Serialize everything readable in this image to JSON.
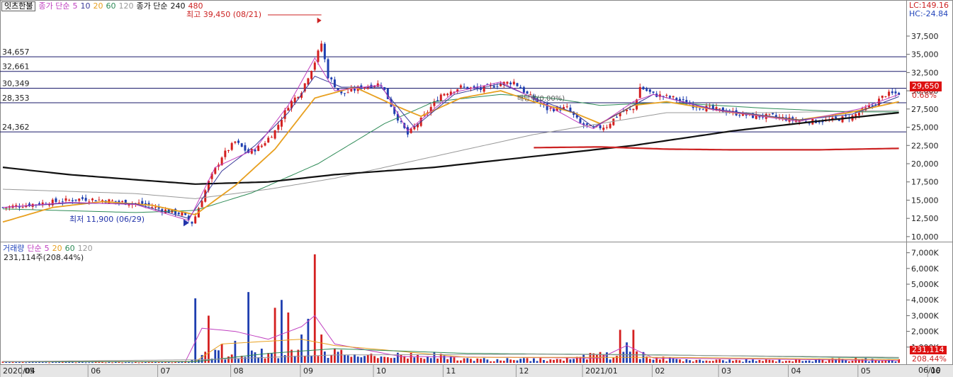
{
  "legend_top": {
    "stock_button": "잇츠한불",
    "ma_prefix": "종가 단순",
    "ma_items": [
      {
        "label": "5",
        "color": "#c040c0"
      },
      {
        "label": "10",
        "color": "#3a3a9a"
      },
      {
        "label": "20",
        "color": "#e8a020"
      },
      {
        "label": "60",
        "color": "#2e8b57"
      },
      {
        "label": "120",
        "color": "#999999"
      }
    ],
    "ma_prefix2": "종가 단순",
    "ma_items2": [
      {
        "label": "240",
        "color": "#111111"
      },
      {
        "label": "480",
        "color": "#cc2222"
      }
    ]
  },
  "top_right": {
    "lc": "LC:149.16",
    "hc": "HC:-24.84"
  },
  "price_axis": {
    "ticks": [
      "37,500",
      "35,000",
      "32,500",
      "30,000",
      "27,500",
      "25,000",
      "22,500",
      "20,000",
      "17,500",
      "15,000",
      "12,500",
      "10,000"
    ],
    "current_price": "29,650",
    "change_pct": "0.68%"
  },
  "h_lines": [
    {
      "label": "34,657",
      "value": 34657
    },
    {
      "label": "32,661",
      "value": 32661
    },
    {
      "label": "30,349",
      "value": 30349
    },
    {
      "label": "28,353",
      "value": 28353
    },
    {
      "label": "24,362",
      "value": 24362
    }
  ],
  "annotations": {
    "high": "최고 39,450 (08/21)",
    "low": "최저 11,900 (06/29)",
    "dividend": "배당락(0.00%)"
  },
  "volume_panel": {
    "legend_prefix": "거래량",
    "legend_ma": "단순",
    "ma_items": [
      {
        "label": "5",
        "color": "#c040c0"
      },
      {
        "label": "20",
        "color": "#e8a020"
      },
      {
        "label": "60",
        "color": "#2e8b57"
      },
      {
        "label": "120",
        "color": "#999999"
      }
    ],
    "current_volume_text": "231,114주(208.44%)",
    "axis_ticks": [
      "7,000K",
      "6,000K",
      "5,000K",
      "4,000K",
      "3,000K",
      "2,000K",
      "1,000K"
    ],
    "current_volume_box": "231,114",
    "current_pct": "208.44%"
  },
  "x_axis": {
    "labels": [
      "2020/04",
      "05",
      "06",
      "07",
      "08",
      "09",
      "10",
      "11",
      "12",
      "2021/01",
      "02",
      "03",
      "04",
      "05",
      "06"
    ],
    "corner_date": "06/10"
  },
  "chart_data": {
    "type": "candlestick",
    "price_range": [
      9600,
      40700
    ],
    "volume_range_k": [
      0,
      7300
    ],
    "months": [
      "2020/04",
      "05",
      "06",
      "07",
      "08",
      "09",
      "10",
      "11",
      "12",
      "2021/01",
      "02",
      "03",
      "04",
      "05",
      "06"
    ],
    "high": {
      "value": 39450,
      "date": "08/21"
    },
    "low": {
      "value": 11900,
      "date": "06/29"
    },
    "last_close": 29650,
    "last_volume": 231114,
    "horizontal_levels": [
      34657,
      32661,
      30349,
      28353,
      24362
    ],
    "close_path": [
      [
        0,
        14000
      ],
      [
        6,
        14300
      ],
      [
        12,
        14600
      ],
      [
        18,
        14900
      ],
      [
        24,
        15200
      ],
      [
        30,
        15000
      ],
      [
        36,
        14700
      ],
      [
        42,
        14500
      ],
      [
        48,
        13700
      ],
      [
        54,
        13100
      ],
      [
        57,
        11900
      ],
      [
        58,
        12800
      ],
      [
        62,
        17500
      ],
      [
        66,
        21000
      ],
      [
        70,
        23000
      ],
      [
        74,
        21500
      ],
      [
        78,
        22500
      ],
      [
        82,
        24500
      ],
      [
        86,
        28000
      ],
      [
        90,
        30000
      ],
      [
        94,
        34000
      ],
      [
        96,
        36500
      ],
      [
        98,
        32000
      ],
      [
        102,
        29500
      ],
      [
        108,
        30500
      ],
      [
        114,
        31000
      ],
      [
        118,
        27000
      ],
      [
        122,
        24000
      ],
      [
        126,
        26000
      ],
      [
        132,
        29500
      ],
      [
        138,
        30500
      ],
      [
        144,
        30200
      ],
      [
        150,
        31000
      ],
      [
        154,
        31200
      ],
      [
        158,
        29500
      ],
      [
        164,
        27500
      ],
      [
        170,
        27600
      ],
      [
        174,
        25500
      ],
      [
        178,
        24800
      ],
      [
        182,
        25200
      ],
      [
        186,
        27000
      ],
      [
        190,
        27500
      ],
      [
        192,
        30500
      ],
      [
        196,
        29500
      ],
      [
        202,
        29000
      ],
      [
        208,
        28000
      ],
      [
        214,
        27500
      ],
      [
        220,
        27000
      ],
      [
        226,
        26500
      ],
      [
        232,
        26500
      ],
      [
        238,
        26000
      ],
      [
        244,
        25800
      ],
      [
        250,
        26000
      ],
      [
        256,
        26500
      ],
      [
        262,
        28000
      ],
      [
        266,
        29500
      ],
      [
        270,
        29650
      ]
    ],
    "ma_series": [
      {
        "name": "120",
        "color": "#999999",
        "points": [
          [
            0,
            16500
          ],
          [
            40,
            15900
          ],
          [
            58,
            15200
          ],
          [
            80,
            16500
          ],
          [
            100,
            18000
          ],
          [
            130,
            21000
          ],
          [
            160,
            24000
          ],
          [
            180,
            25500
          ],
          [
            200,
            27000
          ],
          [
            230,
            27000
          ],
          [
            270,
            27300
          ]
        ]
      },
      {
        "name": "60",
        "color": "#2e8b57",
        "points": [
          [
            0,
            13800
          ],
          [
            40,
            13300
          ],
          [
            58,
            13600
          ],
          [
            75,
            16000
          ],
          [
            95,
            20000
          ],
          [
            115,
            25500
          ],
          [
            130,
            28500
          ],
          [
            150,
            29500
          ],
          [
            165,
            29000
          ],
          [
            180,
            28000
          ],
          [
            200,
            28400
          ],
          [
            230,
            27600
          ],
          [
            255,
            27100
          ],
          [
            270,
            27100
          ]
        ]
      },
      {
        "name": "240",
        "color": "#111111",
        "points": [
          [
            0,
            19500
          ],
          [
            20,
            18500
          ],
          [
            40,
            17800
          ],
          [
            58,
            17200
          ],
          [
            80,
            17500
          ],
          [
            100,
            18500
          ],
          [
            130,
            19500
          ],
          [
            160,
            21000
          ],
          [
            190,
            22500
          ],
          [
            220,
            24500
          ],
          [
            245,
            25800
          ],
          [
            270,
            27000
          ]
        ]
      },
      {
        "name": "480",
        "color": "#cc2222",
        "points": [
          [
            160,
            22200
          ],
          [
            180,
            22300
          ],
          [
            200,
            22000
          ],
          [
            220,
            21900
          ],
          [
            245,
            21900
          ],
          [
            270,
            22100
          ]
        ]
      },
      {
        "name": "20",
        "color": "#e8a020",
        "points": [
          [
            0,
            12000
          ],
          [
            15,
            14000
          ],
          [
            30,
            14800
          ],
          [
            45,
            14300
          ],
          [
            58,
            13000
          ],
          [
            70,
            17000
          ],
          [
            82,
            22000
          ],
          [
            94,
            29000
          ],
          [
            106,
            30500
          ],
          [
            118,
            28000
          ],
          [
            126,
            26500
          ],
          [
            138,
            29000
          ],
          [
            150,
            30000
          ],
          [
            160,
            28500
          ],
          [
            172,
            27000
          ],
          [
            180,
            25500
          ],
          [
            190,
            28000
          ],
          [
            200,
            28500
          ],
          [
            220,
            27000
          ],
          [
            240,
            26000
          ],
          [
            255,
            27000
          ],
          [
            270,
            28500
          ]
        ]
      },
      {
        "name": "10",
        "color": "#3a3a9a",
        "points": [
          [
            0,
            14000
          ],
          [
            20,
            14600
          ],
          [
            40,
            14500
          ],
          [
            56,
            12500
          ],
          [
            66,
            19000
          ],
          [
            76,
            22500
          ],
          [
            86,
            27000
          ],
          [
            94,
            32000
          ],
          [
            102,
            30500
          ],
          [
            114,
            30500
          ],
          [
            124,
            25000
          ],
          [
            136,
            29500
          ],
          [
            150,
            31000
          ],
          [
            160,
            29000
          ],
          [
            172,
            27000
          ],
          [
            178,
            25000
          ],
          [
            188,
            27500
          ],
          [
            196,
            29500
          ],
          [
            214,
            27500
          ],
          [
            240,
            26000
          ],
          [
            256,
            26800
          ],
          [
            270,
            29200
          ]
        ]
      },
      {
        "name": "5",
        "color": "#c040c0",
        "points": [
          [
            0,
            14000
          ],
          [
            20,
            14700
          ],
          [
            40,
            14400
          ],
          [
            56,
            12200
          ],
          [
            64,
            19500
          ],
          [
            76,
            22000
          ],
          [
            86,
            28000
          ],
          [
            94,
            34500
          ],
          [
            100,
            30000
          ],
          [
            114,
            30800
          ],
          [
            122,
            24500
          ],
          [
            136,
            29800
          ],
          [
            150,
            31200
          ],
          [
            162,
            28500
          ],
          [
            174,
            25500
          ],
          [
            178,
            24800
          ],
          [
            190,
            28500
          ],
          [
            196,
            29500
          ],
          [
            214,
            27400
          ],
          [
            240,
            25800
          ],
          [
            258,
            27500
          ],
          [
            270,
            29500
          ]
        ]
      }
    ],
    "volume_k": [
      [
        0,
        80
      ],
      [
        20,
        80
      ],
      [
        40,
        80
      ],
      [
        55,
        100
      ],
      [
        57,
        200
      ],
      [
        58,
        4100
      ],
      [
        60,
        500
      ],
      [
        62,
        3000
      ],
      [
        66,
        1200
      ],
      [
        70,
        1400
      ],
      [
        74,
        4500
      ],
      [
        78,
        900
      ],
      [
        82,
        3500
      ],
      [
        84,
        4000
      ],
      [
        86,
        3200
      ],
      [
        90,
        1800
      ],
      [
        92,
        2800
      ],
      [
        94,
        6900
      ],
      [
        96,
        1800
      ],
      [
        100,
        900
      ],
      [
        110,
        500
      ],
      [
        130,
        700
      ],
      [
        140,
        300
      ],
      [
        152,
        300
      ],
      [
        158,
        300
      ],
      [
        170,
        300
      ],
      [
        178,
        600
      ],
      [
        186,
        2100
      ],
      [
        188,
        1300
      ],
      [
        190,
        2100
      ],
      [
        194,
        400
      ],
      [
        210,
        200
      ],
      [
        240,
        200
      ],
      [
        260,
        300
      ],
      [
        270,
        231
      ]
    ]
  }
}
